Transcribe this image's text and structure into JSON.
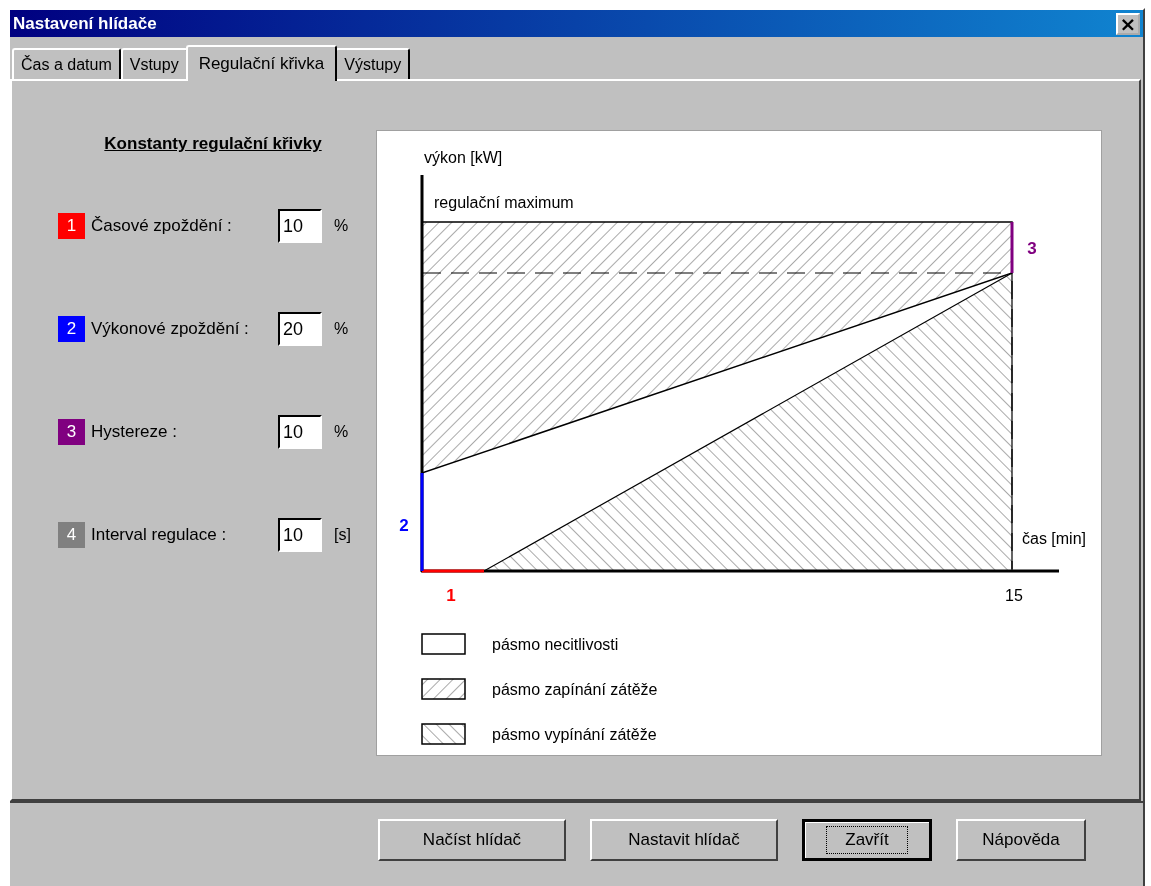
{
  "window": {
    "title": "Nastavení hlídače",
    "close": "×"
  },
  "tabs": [
    {
      "label": "Čas a datum",
      "selected": false
    },
    {
      "label": "Vstupy",
      "selected": false
    },
    {
      "label": "Regulační křivka",
      "selected": true
    },
    {
      "label": "Výstupy",
      "selected": false
    }
  ],
  "constants": {
    "heading": "Konstanty regulační křivky",
    "rows": [
      {
        "badge": "1",
        "color": "#ff0000",
        "label": "Časové zpoždění :",
        "value": "10",
        "unit": "%"
      },
      {
        "badge": "2",
        "color": "#0000ff",
        "label": "Výkonové zpoždění :",
        "value": "20",
        "unit": "%"
      },
      {
        "badge": "3",
        "color": "#800080",
        "label": "Hystereze :",
        "value": "10",
        "unit": "%"
      },
      {
        "badge": "4",
        "color": "#808080",
        "label": "Interval regulace :",
        "value": "10",
        "unit": "[s]"
      }
    ]
  },
  "diagram": {
    "ylabel": "výkon [kW]",
    "max_label": "regulační maximum",
    "xlabel": "čas [min]",
    "xtick": "15",
    "markers": [
      {
        "text": "1",
        "color": "#ff0000"
      },
      {
        "text": "2",
        "color": "#0000ff"
      },
      {
        "text": "3",
        "color": "#800080"
      }
    ],
    "legend": [
      {
        "kind": "empty",
        "label": "pásmo necitlivosti"
      },
      {
        "kind": "hatch-up",
        "label": "pásmo zapínání zátěže"
      },
      {
        "kind": "hatch-down",
        "label": "pásmo vypínání zátěže"
      }
    ]
  },
  "buttons": [
    {
      "label": "Načíst hlídač",
      "default": false
    },
    {
      "label": "Nastavit hlídač",
      "default": false
    },
    {
      "label": "Zavřít",
      "default": true
    },
    {
      "label": "Nápověda",
      "default": false
    }
  ]
}
